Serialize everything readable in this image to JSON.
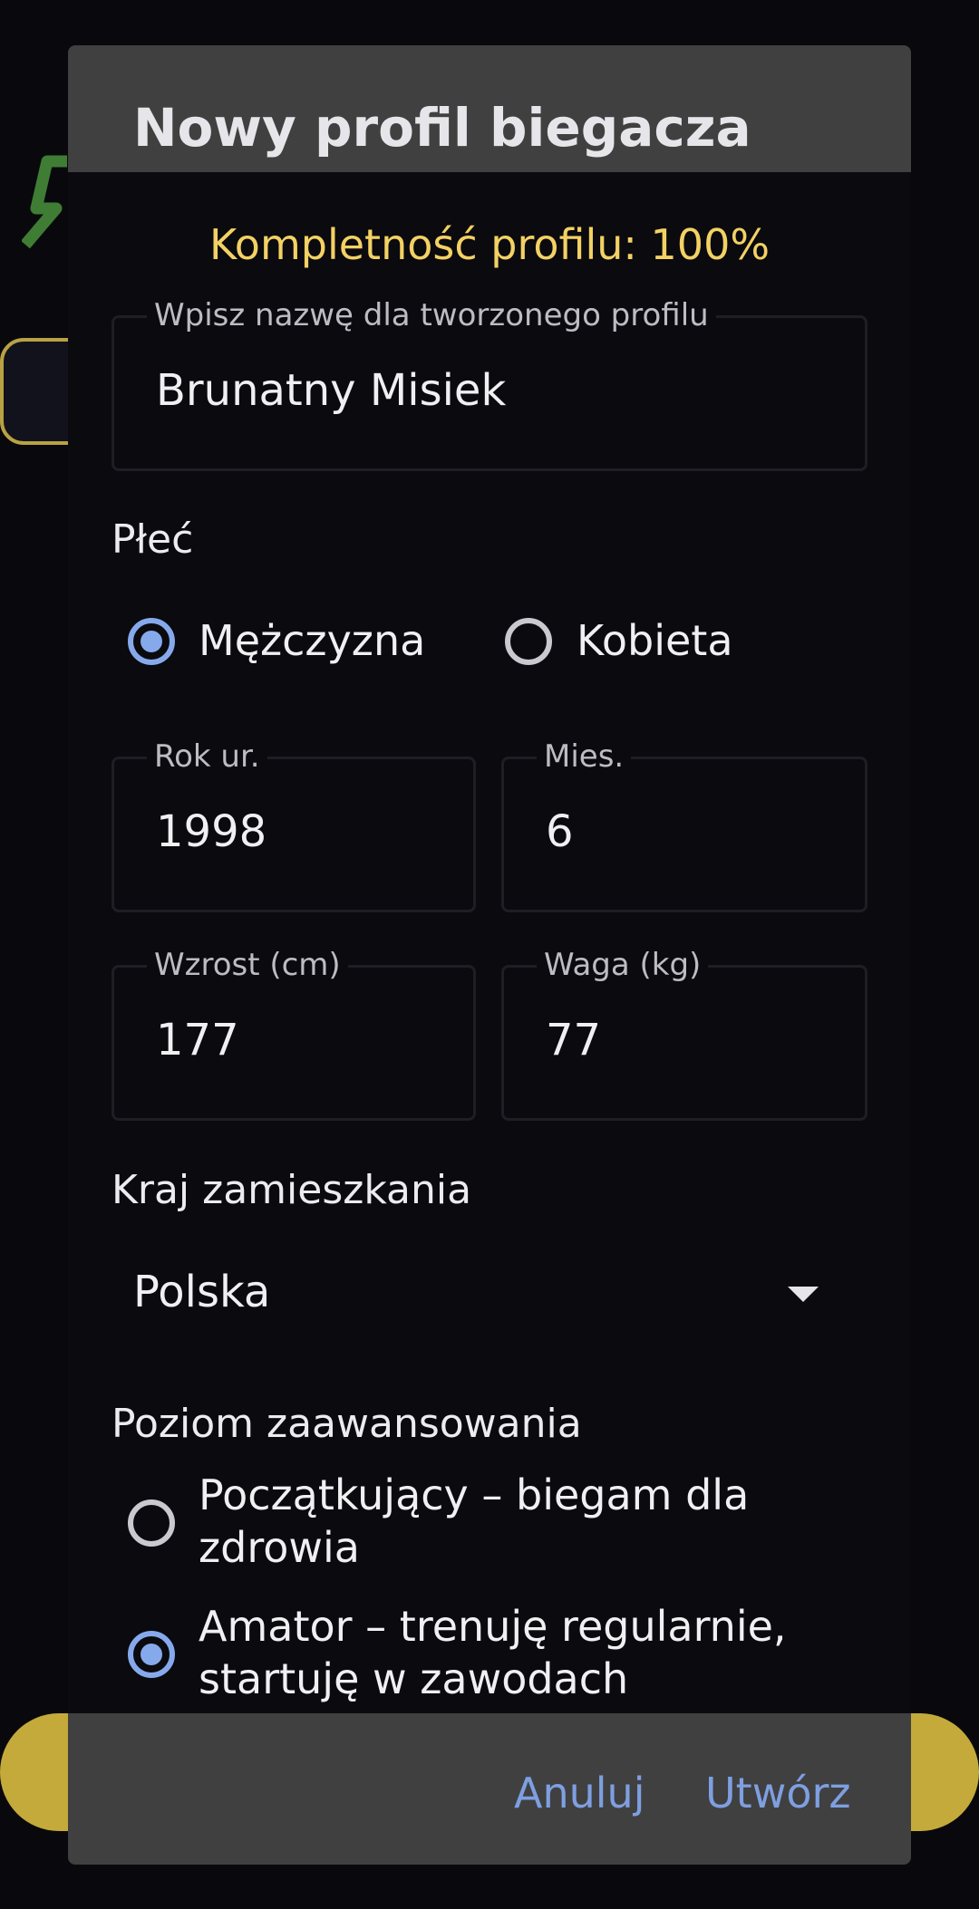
{
  "dialog": {
    "title": "Nowy profil biegacza",
    "completeness": "Kompletność profilu: 100%"
  },
  "profile_name": {
    "label": "Wpisz nazwę dla tworzonego profilu",
    "value": "Brunatny Misiek"
  },
  "gender": {
    "label": "Płeć",
    "options": [
      {
        "label": "Mężczyzna",
        "checked": true
      },
      {
        "label": "Kobieta",
        "checked": false
      }
    ]
  },
  "birth_year": {
    "label": "Rok ur.",
    "value": "1998"
  },
  "birth_month": {
    "label": "Mies.",
    "value": "6"
  },
  "height": {
    "label": "Wzrost (cm)",
    "value": "177"
  },
  "weight": {
    "label": "Waga (kg)",
    "value": "77"
  },
  "country": {
    "label": "Kraj zamieszkania",
    "selected": "Polska",
    "icon": "dropdown-arrow-icon"
  },
  "level": {
    "label": "Poziom zaawansowania",
    "options": [
      {
        "label": "Początkujący – biegam dla zdrowia",
        "checked": false
      },
      {
        "label": "Amator – trenuję regularnie, startuję w zawodach",
        "checked": true
      }
    ]
  },
  "footer": {
    "cancel_label": "Anuluj",
    "create_label": "Utwórz"
  },
  "colors": {
    "accent": "#86a9ec",
    "button_text": "#7e9fe1",
    "completeness": "#f3d163",
    "header_bg": "#404040",
    "background_accent": "#c4aa3a"
  }
}
